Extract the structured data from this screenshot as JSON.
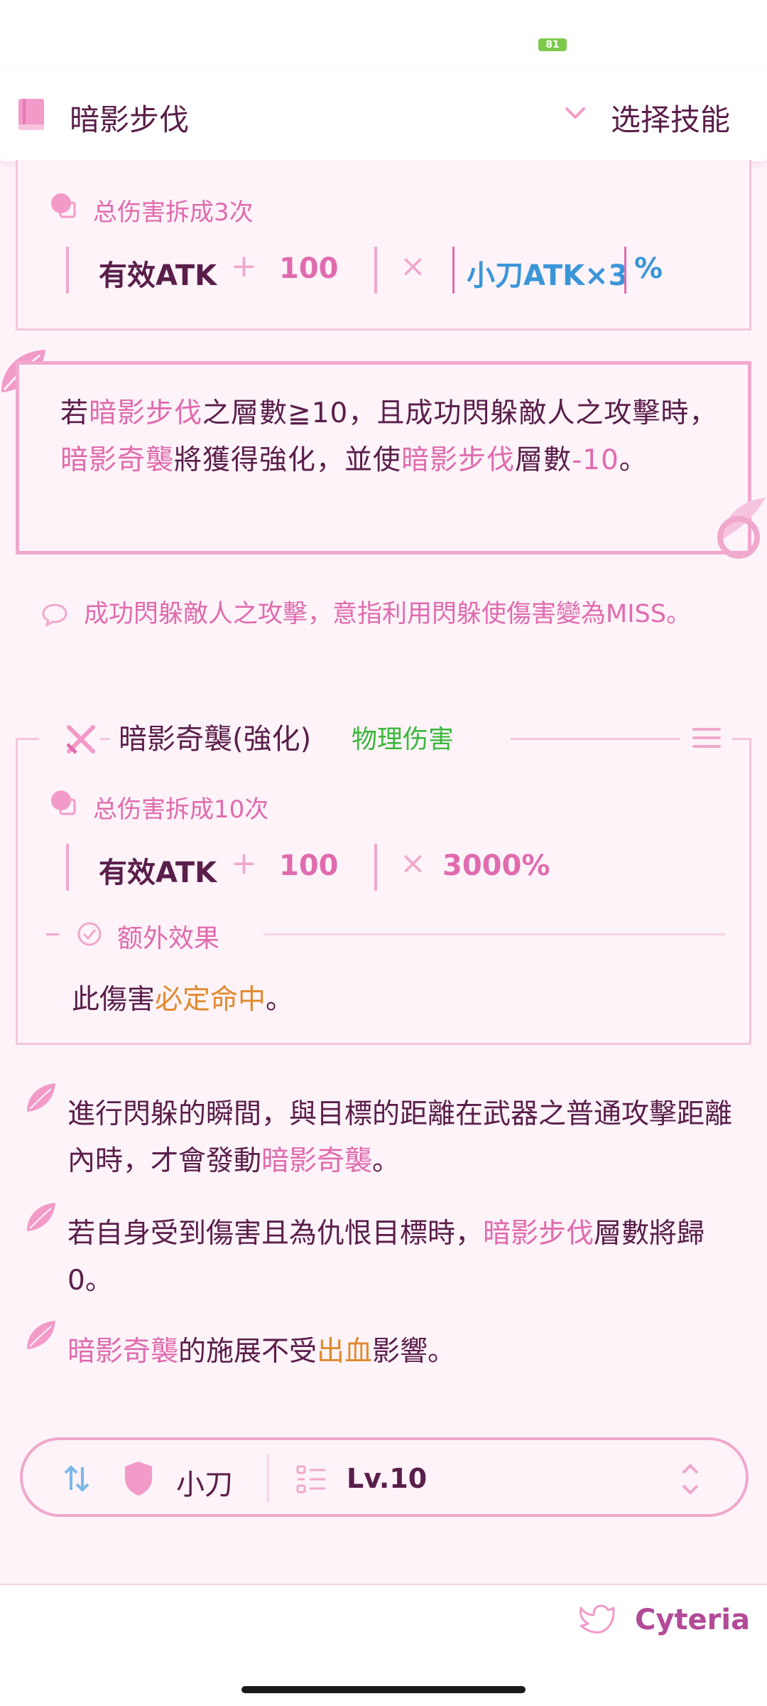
{
  "status": {
    "battery": "81"
  },
  "header": {
    "skill_name": "暗影步伐",
    "choose_label": "选择技能"
  },
  "card1": {
    "damage_split": "总伤害拆成3次",
    "formula": {
      "stat": "有效ATK",
      "plus": "+",
      "add": "100",
      "times": "×",
      "multiplier": "小刀ATK×3",
      "percent": "%"
    }
  },
  "quote": {
    "p1": "若",
    "link1": "暗影步伐",
    "p2": "之層數≧10，且成功閃躲敵人之攻擊時，",
    "link2": "暗影奇襲",
    "p3": "將獲得強化，並使",
    "link3": "暗影步伐",
    "p4": "層數",
    "p5": "-10",
    "p6": "。"
  },
  "note": {
    "text": "成功閃躲敵人之攻擊，意指利用閃躲使傷害變為MISS。"
  },
  "card2": {
    "title": "暗影奇襲(強化)",
    "damage_type": "物理伤害",
    "damage_split": "总伤害拆成10次",
    "formula": {
      "stat": "有效ATK",
      "plus": "+",
      "add": "100",
      "times": "×",
      "multiplier": "3000%"
    },
    "extra_label": "额外效果",
    "extra": {
      "p1": "此傷害",
      "link": "必定命中",
      "p2": "。"
    }
  },
  "bullets": [
    {
      "p1": "進行閃躲的瞬間，與目標的距離在武器之普通攻擊距離內時，才會發動",
      "link": "暗影奇襲",
      "p2": "。"
    },
    {
      "p1": "若自身受到傷害且為仇恨目標時，",
      "link": "暗影步伐",
      "p2": "層數將歸0。"
    },
    {
      "link": "暗影奇襲",
      "p1": "的施展不受",
      "link2": "出血",
      "p2": "影響。"
    }
  ],
  "controls": {
    "weapon": "小刀",
    "level": "Lv.10"
  },
  "footer": {
    "brand": "Cyteria"
  },
  "colors": {
    "accent": "#e06bae",
    "border": "#f0a8cc",
    "text": "#5a1e4a",
    "green": "#3ab83a",
    "orange": "#e08a2e",
    "blue": "#3b96d8"
  }
}
